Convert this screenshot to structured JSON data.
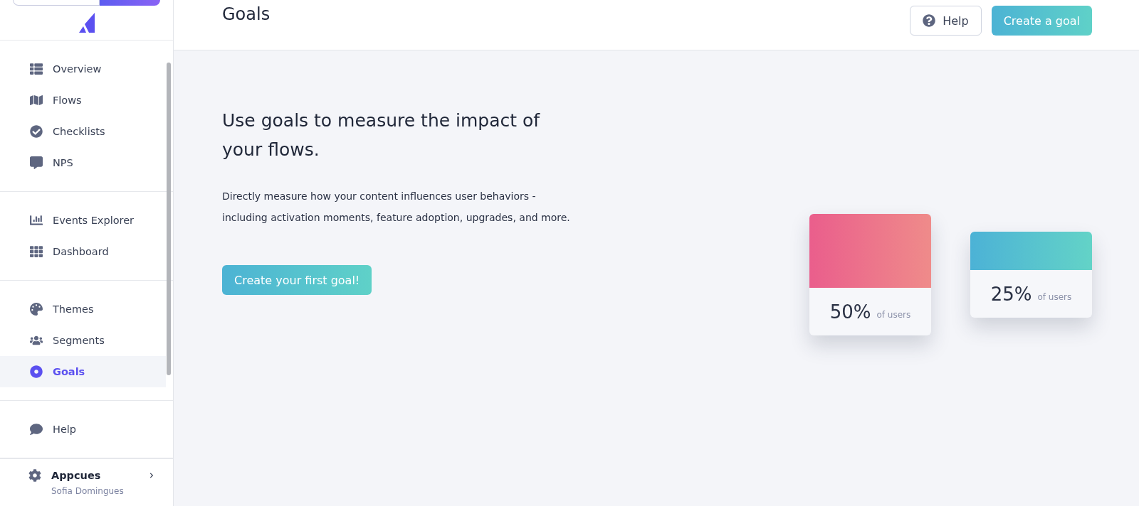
{
  "sidebar": {
    "nav_groups": [
      {
        "items": [
          {
            "label": "Overview",
            "selected": false
          },
          {
            "label": "Flows",
            "selected": false
          },
          {
            "label": "Checklists",
            "selected": false
          },
          {
            "label": "NPS",
            "selected": false
          }
        ]
      },
      {
        "items": [
          {
            "label": "Events Explorer",
            "selected": false
          },
          {
            "label": "Dashboard",
            "selected": false
          }
        ]
      },
      {
        "items": [
          {
            "label": "Themes",
            "selected": false
          },
          {
            "label": "Segments",
            "selected": false
          },
          {
            "label": "Goals",
            "selected": true
          }
        ]
      },
      {
        "items": [
          {
            "label": "Help",
            "selected": false
          }
        ]
      }
    ],
    "account": {
      "name": "Appcues",
      "user": "Sofia Domingues"
    }
  },
  "header": {
    "title": "Goals",
    "help_button": "Help",
    "create_button": "Create a goal"
  },
  "intro": {
    "heading": "Use goals to measure the impact of your flows.",
    "body_lines": [
      "Directly measure how your content influences user behaviors -",
      "including activation moments, feature adoption, upgrades, and more."
    ],
    "cta": "Create your first goal!"
  },
  "cards": [
    {
      "value": "50%",
      "caption": "of users"
    },
    {
      "value": "25%",
      "caption": "of users"
    }
  ]
}
